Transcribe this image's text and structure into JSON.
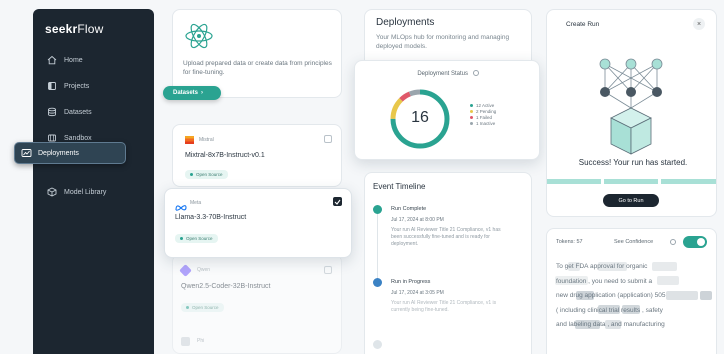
{
  "sidebar": {
    "logo_main": "seekr",
    "logo_light": "Flow",
    "items": [
      {
        "label": "Home",
        "icon": "home-icon"
      },
      {
        "label": "Projects",
        "icon": "projects-icon"
      },
      {
        "label": "Datasets",
        "icon": "database-icon"
      },
      {
        "label": "Sandbox",
        "icon": "sandbox-icon"
      },
      {
        "label": "Deployments",
        "icon": "deployments-icon",
        "active": true
      },
      {
        "label": "Model Library",
        "icon": "cube-icon"
      }
    ]
  },
  "datasets_card": {
    "icon": "atom-icon",
    "description": "Upload prepared data or create data from principles for fine-tuning.",
    "button_label": "Datasets"
  },
  "models": [
    {
      "org": "Mistral",
      "name": "Mixtral-8x7B-Instruct-v0.1",
      "badge": "Open Source",
      "checked": false
    },
    {
      "org": "Meta",
      "name": "Llama-3.3-70B-Instruct",
      "badge": "Open Source",
      "checked": true
    },
    {
      "org": "Qwen",
      "name": "Qwen2.5-Coder-32B-Instruct",
      "badge": "Open Source",
      "checked": false
    },
    {
      "org": "Phi",
      "name": "",
      "badge": "",
      "checked": false
    }
  ],
  "deployments": {
    "title": "Deployments",
    "subtitle": "Your MLOps hub for monitoring and managing deployed models.",
    "status": {
      "title": "Deployment Status",
      "total": "16",
      "legend": [
        {
          "label": "12 Active",
          "color": "#2aa391",
          "value": 12
        },
        {
          "label": "2 Pending",
          "color": "#e8c74a",
          "value": 2
        },
        {
          "label": "1 Failed",
          "color": "#e0596a",
          "value": 1
        },
        {
          "label": "1 Inactive",
          "color": "#9aa5ad",
          "value": 1
        }
      ]
    }
  },
  "timeline": {
    "title": "Event Timeline",
    "events": [
      {
        "head": "Run Complete",
        "date": "Jul 17, 2024 at 8:00 PM",
        "body": "Your run AI Reviewer Title 21 Compliance, v1 has been successfully fine-tuned and is ready for deployment.",
        "color": "#2aa391"
      },
      {
        "head": "Run in Progress",
        "date": "Jul 17, 2024 at 3:05 PM",
        "body": "Your run AI Reviewer Title 21 Compliance, v1 is currently being fine-tuned.",
        "color": "#3b82c4"
      }
    ]
  },
  "create_run": {
    "title": "Create Run",
    "close": "×",
    "success": "Success! Your run has started.",
    "button_label": "Go to Run"
  },
  "tokens_panel": {
    "tokens_label": "Tokens: 57",
    "confidence_label": "See Confidence",
    "text_lines": [
      "To get FDA approval for organic",
      "foundation , you need to submit a",
      "new drug application (application) 505",
      "( including clinical trial results , safety",
      "and labeling data , and manufacturing"
    ]
  }
}
